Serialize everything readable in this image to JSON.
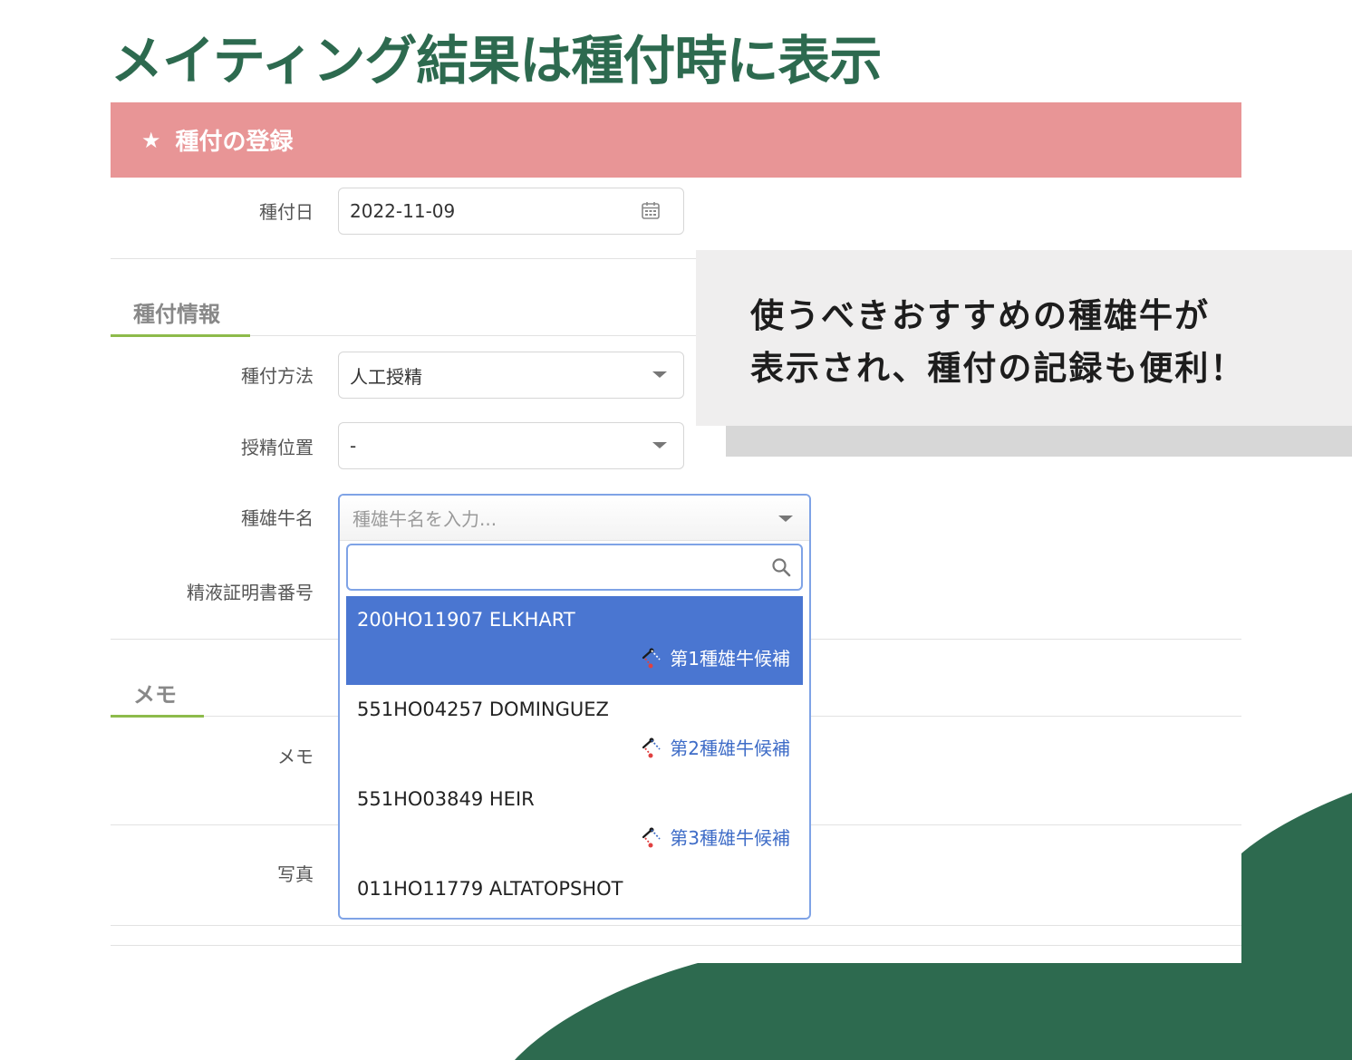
{
  "headline": "メイティング結果は種付時に表示",
  "card": {
    "title": "種付の登録",
    "star_icon": "star-icon"
  },
  "form": {
    "date_label": "種付日",
    "date_value": "2022-11-09",
    "section_info": "種付情報",
    "method_label": "種付方法",
    "method_value": "人工授精",
    "position_label": "授精位置",
    "position_value": "-",
    "bull_label": "種雄牛名",
    "bull_placeholder": "種雄牛名を入力...",
    "cert_label": "精液証明書番号",
    "section_memo": "メモ",
    "memo_label": "メモ",
    "photo_label": "写真"
  },
  "dropdown": {
    "options": [
      {
        "name": "200HO11907 ELKHART",
        "badge": "第1種雄牛候補",
        "active": true
      },
      {
        "name": "551HO04257 DOMINGUEZ",
        "badge": "第2種雄牛候補",
        "active": false
      },
      {
        "name": "551HO03849 HEIR",
        "badge": "第3種雄牛候補",
        "active": false
      },
      {
        "name": "011HO11779 ALTATOPSHOT",
        "badge": "",
        "active": false
      }
    ]
  },
  "callout": {
    "line1": "使うべきおすすめの種雄牛が",
    "line2": "表示され、種付の記録も便利！"
  },
  "colors": {
    "brand_green": "#2d6a4f",
    "header_pink": "#e89596",
    "active_blue": "#4a76d1",
    "accent_green": "#8dbb4b"
  }
}
